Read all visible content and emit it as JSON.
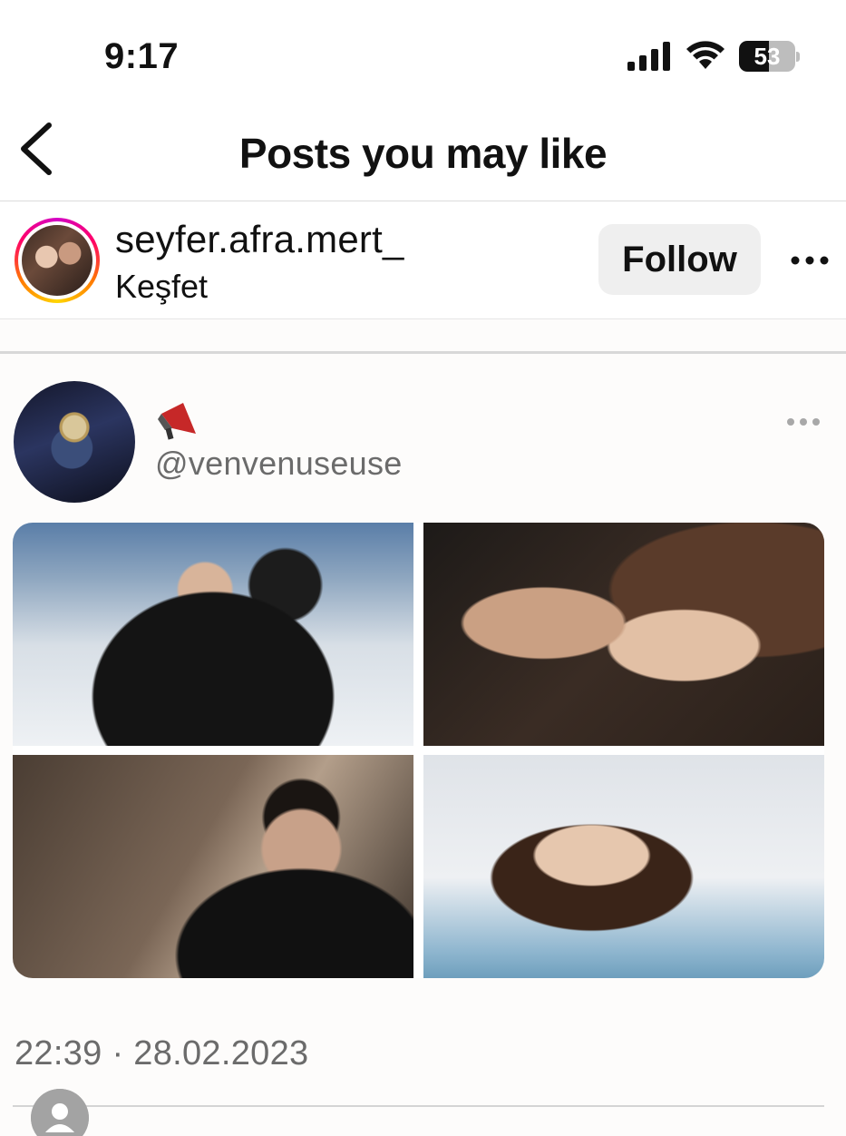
{
  "status_bar": {
    "time": "9:17",
    "battery_text": "53",
    "battery_level": 0.53
  },
  "header": {
    "title": "Posts you may like"
  },
  "post": {
    "username": "seyfer.afra.mert_",
    "subtitle": "Keşfet",
    "follow_label": "Follow"
  },
  "tweet": {
    "handle": "@venvenuseuse",
    "timestamp": "22:39 · 28.02.2023"
  },
  "colors": {
    "follow_bg": "#efefef",
    "story_ring": [
      "#d300c5",
      "#ff0069",
      "#ff7a00",
      "#ffd600"
    ],
    "secondary_text": "#6b6b6b"
  },
  "icons": {
    "back": "chevron-left-icon",
    "more": "more-horizontal-icon",
    "signal": "cellular-signal-icon",
    "wifi": "wifi-icon",
    "battery": "battery-icon",
    "emoji": "megaphone-emoji-icon",
    "person": "person-icon"
  }
}
